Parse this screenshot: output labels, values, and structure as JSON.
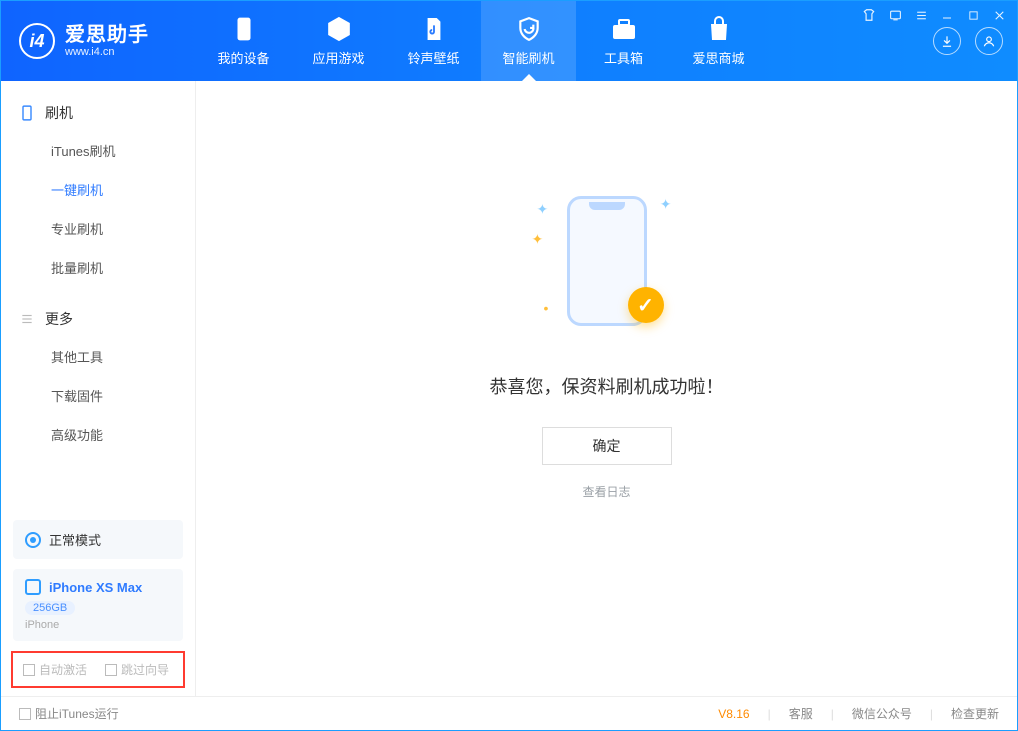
{
  "brand": {
    "title": "爱思助手",
    "subtitle": "www.i4.cn",
    "logo_letter": "i4"
  },
  "nav": {
    "items": [
      {
        "label": "我的设备"
      },
      {
        "label": "应用游戏"
      },
      {
        "label": "铃声壁纸"
      },
      {
        "label": "智能刷机"
      },
      {
        "label": "工具箱"
      },
      {
        "label": "爱思商城"
      }
    ],
    "active_index": 3
  },
  "sidebar": {
    "group1": {
      "title": "刷机",
      "items": [
        {
          "label": "iTunes刷机"
        },
        {
          "label": "一键刷机"
        },
        {
          "label": "专业刷机"
        },
        {
          "label": "批量刷机"
        }
      ],
      "active_index": 1
    },
    "group2": {
      "title": "更多",
      "items": [
        {
          "label": "其他工具"
        },
        {
          "label": "下载固件"
        },
        {
          "label": "高级功能"
        }
      ]
    }
  },
  "mode_card": {
    "label": "正常模式"
  },
  "device_card": {
    "name": "iPhone XS Max",
    "capacity": "256GB",
    "type": "iPhone"
  },
  "options": {
    "opt1": "自动激活",
    "opt2": "跳过向导"
  },
  "main": {
    "success_message": "恭喜您，保资料刷机成功啦！",
    "ok_button": "确定",
    "view_log": "查看日志"
  },
  "footer": {
    "block_itunes": "阻止iTunes运行",
    "version": "V8.16",
    "links": {
      "kefu": "客服",
      "wechat": "微信公众号",
      "update": "检查更新"
    }
  }
}
